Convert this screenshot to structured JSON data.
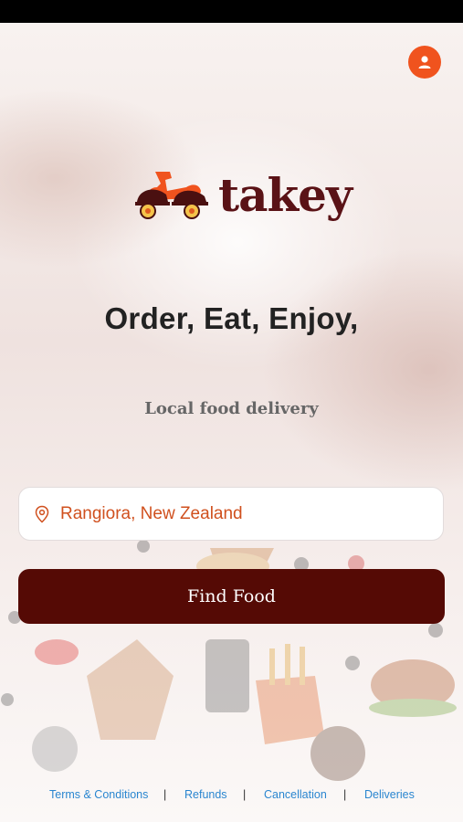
{
  "brand": {
    "name": "takey"
  },
  "hero": {
    "headline": "Order, Eat, Enjoy,",
    "subline": "Local food delivery"
  },
  "location": {
    "value": "Rangiora, New Zealand"
  },
  "actions": {
    "find_food": "Find Food"
  },
  "footer": {
    "links": [
      "Terms & Conditions",
      "Refunds",
      "Cancellation",
      "Deliveries"
    ],
    "separator": "|"
  },
  "colors": {
    "accent": "#f0531e",
    "primary_button": "#550a05",
    "brand_text": "#5a1216",
    "link": "#2a86d0"
  },
  "icons": {
    "profile": "user-icon",
    "location": "map-pin-icon"
  }
}
